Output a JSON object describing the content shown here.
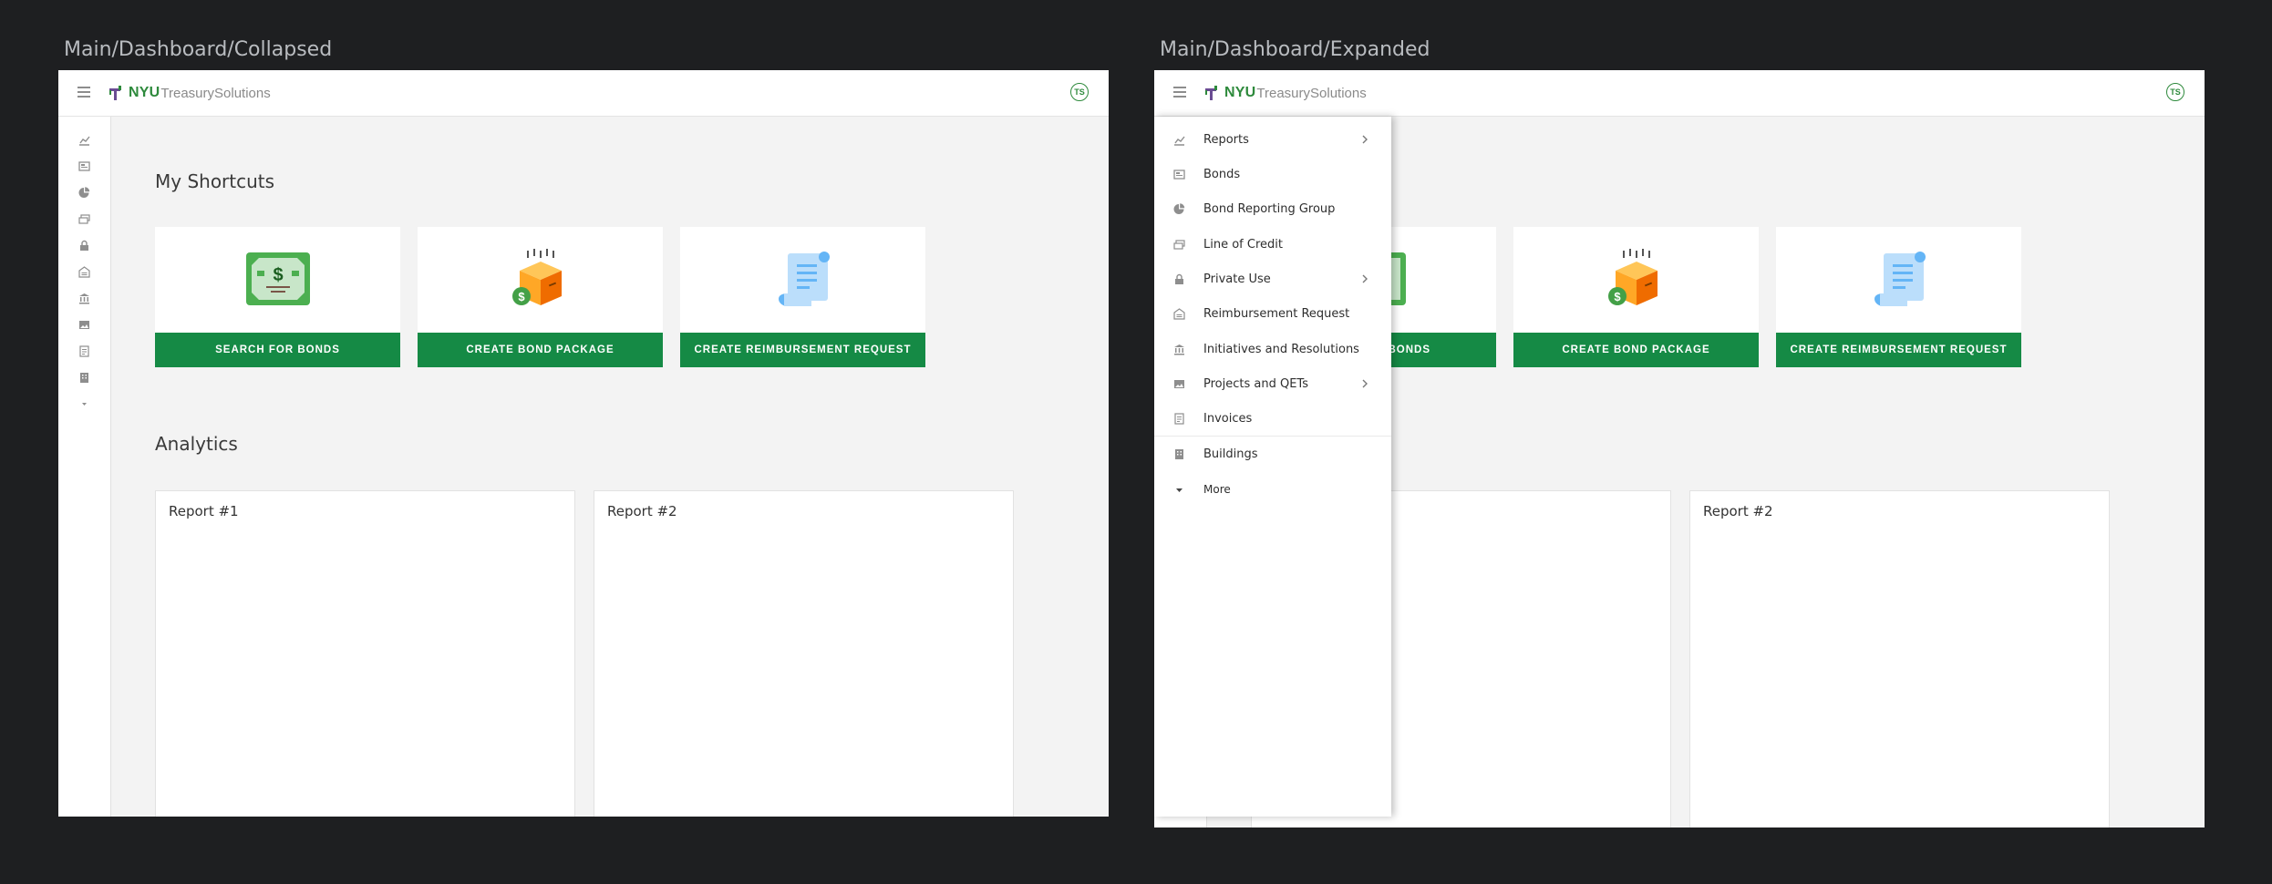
{
  "frames": {
    "collapsed_title": "Main/Dashboard/Collapsed",
    "expanded_title": "Main/Dashboard/Expanded"
  },
  "header": {
    "logo_bold": "NYU",
    "logo_rest": "TreasurySolutions",
    "avatar_initials": "TS",
    "hamburger_icon": "hamburger-icon"
  },
  "sections": {
    "shortcuts_title": "My Shortcuts",
    "analytics_title": "Analytics"
  },
  "shortcuts": [
    {
      "label": "SEARCH FOR BONDS",
      "icon": "money-bill-icon"
    },
    {
      "label": "CREATE BOND PACKAGE",
      "icon": "package-dollar-icon"
    },
    {
      "label": "CREATE REIMBURSEMENT REQUEST",
      "icon": "scroll-document-icon"
    }
  ],
  "shortcut_partial_label": "BONDS",
  "reports": [
    {
      "title": "Report #1"
    },
    {
      "title": "Report #2"
    }
  ],
  "menu": {
    "items": [
      {
        "label": "Reports",
        "icon": "chart-icon",
        "has_submenu": true
      },
      {
        "label": "Bonds",
        "icon": "certificate-icon",
        "has_submenu": false
      },
      {
        "label": "Bond Reporting Group",
        "icon": "pie-chart-icon",
        "has_submenu": false
      },
      {
        "label": "Line of Credit",
        "icon": "cash-icon",
        "has_submenu": false
      },
      {
        "label": "Private Use",
        "icon": "lock-icon",
        "has_submenu": true
      },
      {
        "label": "Reimbursement Request",
        "icon": "garage-icon",
        "has_submenu": false
      },
      {
        "label": "Initiatives and Resolutions",
        "icon": "institution-icon",
        "has_submenu": false
      },
      {
        "label": "Projects and QETs",
        "icon": "image-icon",
        "has_submenu": true
      },
      {
        "label": "Invoices",
        "icon": "invoice-icon",
        "has_submenu": false
      },
      {
        "label": "Buildings",
        "icon": "building-icon",
        "has_submenu": false
      }
    ],
    "more_label": "More",
    "more_icon": "caret-down-icon"
  },
  "colors": {
    "brand_green": "#158a45",
    "logo_green": "#2e8a3c",
    "page_bg": "#1e1f21",
    "content_bg": "#f3f3f3"
  }
}
